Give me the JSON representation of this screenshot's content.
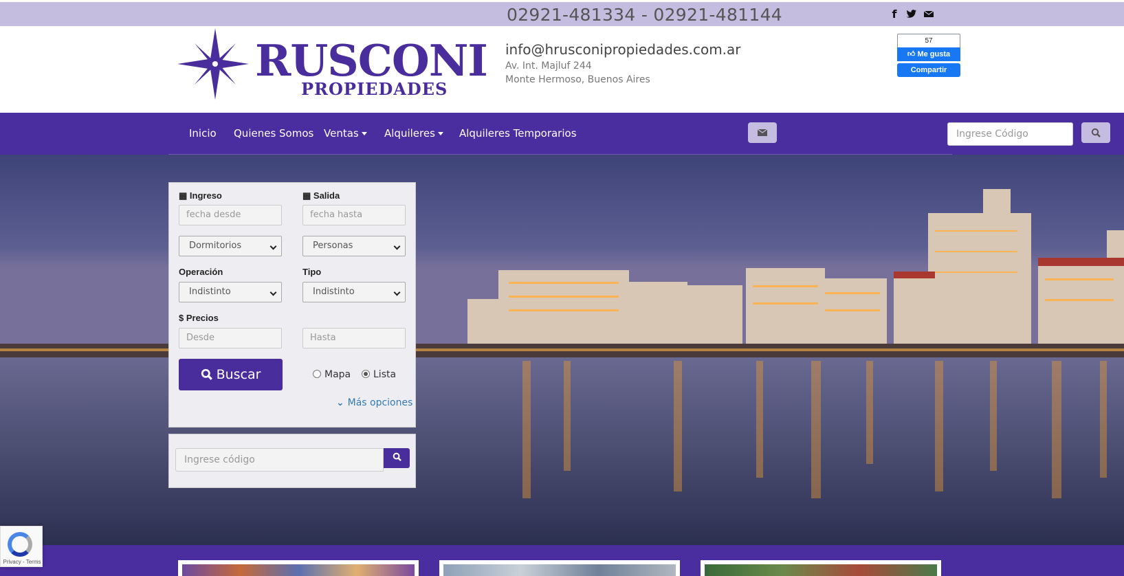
{
  "topbar": {
    "phones": "02921-481334 - 02921-481144",
    "social": [
      {
        "icon": "facebook-icon",
        "glyph": "f"
      },
      {
        "icon": "twitter-icon",
        "glyph": "t"
      },
      {
        "icon": "envelope-icon",
        "glyph": "✉"
      }
    ]
  },
  "header": {
    "logo_word": "RUSCONI",
    "logo_sub": "PROPIEDADES",
    "email": "info@hrusconipropiedades.com.ar",
    "address_line1": "Av. Int. Majluf 244",
    "address_line2": "Monte Hermoso, Buenos Aires",
    "fb_count": "57",
    "fb_like": "Me gusta",
    "fb_share": "Compartir"
  },
  "nav": {
    "items": [
      "Inicio",
      "Quienes Somos",
      "Ventas",
      "Alquileres",
      "Alquileres Temporarios"
    ],
    "search_placeholder": "Ingrese Código"
  },
  "search": {
    "ingreso_label": "Ingreso",
    "salida_label": "Salida",
    "fecha_desde": "fecha desde",
    "fecha_hasta": "fecha hasta",
    "dormitorios": "Dormitorios",
    "personas": "Personas",
    "operacion_label": "Operación",
    "tipo_label": "Tipo",
    "operacion_value": "Indistinto",
    "tipo_value": "Indistinto",
    "precios_label": "$ Precios",
    "desde": "Desde",
    "hasta": "Hasta",
    "buscar": "Buscar",
    "mapa": "Mapa",
    "lista": "Lista",
    "selected_view": "Lista",
    "mas_opciones": "Más opciones",
    "code_placeholder": "Ingrese código"
  },
  "recaptcha": {
    "text": "Privacy - Terms"
  },
  "colors": {
    "brand": "#4a2d9e",
    "topbar": "#c5bde0",
    "link": "#337ab7"
  }
}
